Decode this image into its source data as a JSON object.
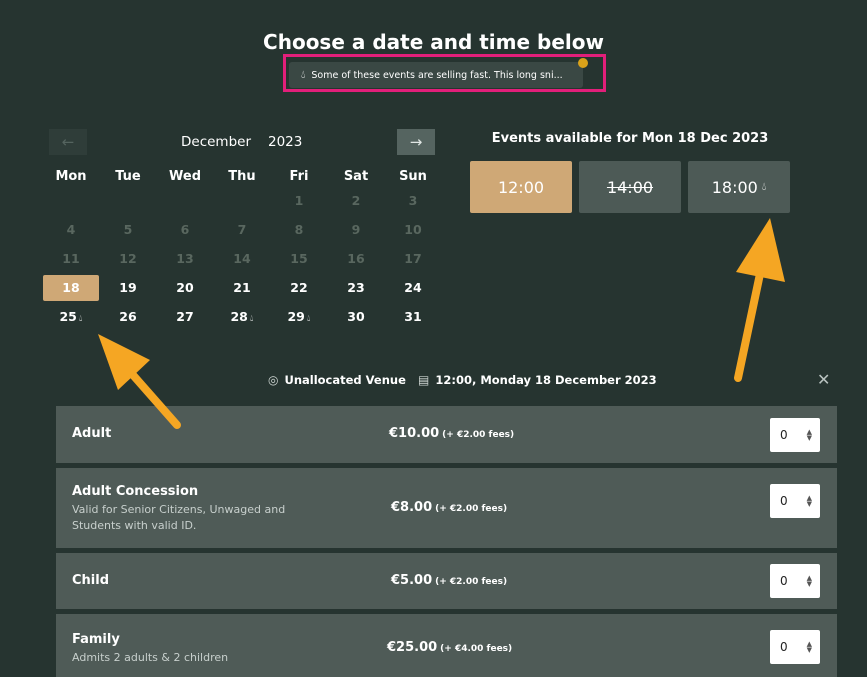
{
  "header": {
    "title": "Choose a date and time below",
    "alert_text": "Some of these events are selling fast. This long sni..."
  },
  "calendar": {
    "month": "December",
    "year": "2023",
    "prev_icon": "←",
    "next_icon": "→",
    "weekdays": [
      "Mon",
      "Tue",
      "Wed",
      "Thu",
      "Fri",
      "Sat",
      "Sun"
    ],
    "weeks": [
      [
        "",
        "",
        "",
        "",
        "1",
        "2",
        "3"
      ],
      [
        "4",
        "5",
        "6",
        "7",
        "8",
        "9",
        "10"
      ],
      [
        "11",
        "12",
        "13",
        "14",
        "15",
        "16",
        "17"
      ],
      [
        "18",
        "19",
        "20",
        "21",
        "22",
        "23",
        "24"
      ],
      [
        "25",
        "26",
        "27",
        "28",
        "29",
        "30",
        "31"
      ]
    ],
    "selected_day": "18",
    "selling_fast_days": [
      "25",
      "28",
      "29"
    ]
  },
  "events": {
    "title": "Events available for Mon 18 Dec 2023",
    "times": [
      {
        "label": "12:00",
        "state": "selected"
      },
      {
        "label": "14:00",
        "state": "sold-out"
      },
      {
        "label": "18:00",
        "state": "selling-fast"
      }
    ]
  },
  "info": {
    "venue": "Unallocated Venue",
    "datetime": "12:00,  Monday 18 December 2023"
  },
  "tickets": [
    {
      "name": "Adult",
      "desc": "",
      "price": "€10.00",
      "fees": "(+ €2.00 fees)",
      "qty": "0"
    },
    {
      "name": "Adult Concession",
      "desc": "Valid for Senior Citizens, Unwaged and Students with valid ID.",
      "price": "€8.00",
      "fees": "(+ €2.00 fees)",
      "qty": "0"
    },
    {
      "name": "Child",
      "desc": "",
      "price": "€5.00",
      "fees": "(+ €2.00 fees)",
      "qty": "0"
    },
    {
      "name": "Family",
      "desc": "Admits 2 adults & 2 children",
      "price": "€25.00",
      "fees": "(+ €4.00 fees)",
      "qty": "0"
    }
  ],
  "colors": {
    "background": "#263430",
    "accent": "#cfa876",
    "highlight_box": "#e21f7a",
    "annotation_arrow": "#f5a623"
  }
}
